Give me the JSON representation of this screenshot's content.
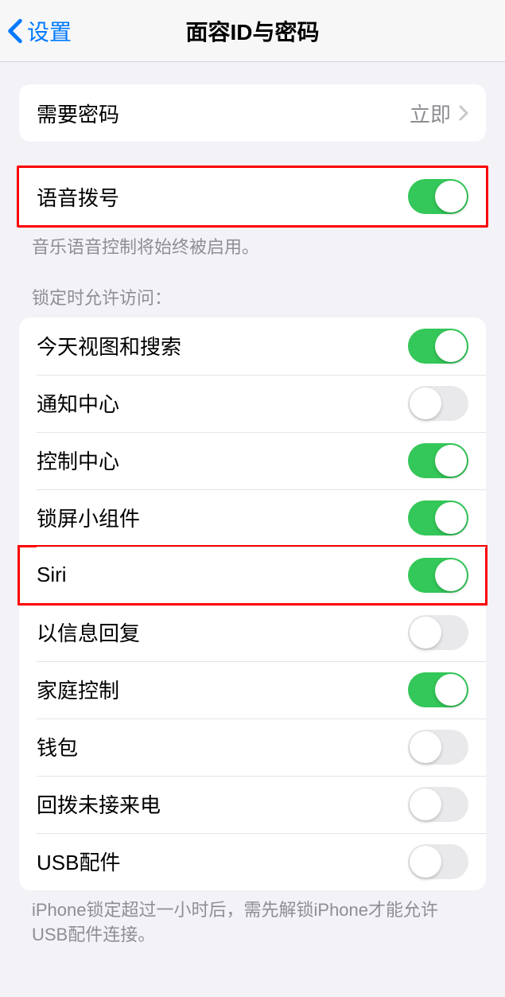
{
  "nav": {
    "back": "设置",
    "title": "面容ID与密码"
  },
  "group1": {
    "require_passcode": "需要密码",
    "require_passcode_value": "立即"
  },
  "group2": {
    "voice_dial": "语音拨号",
    "voice_dial_on": true,
    "footer": "音乐语音控制将始终被启用。"
  },
  "group3": {
    "header": "锁定时允许访问：",
    "items": [
      {
        "label": "今天视图和搜索",
        "on": true
      },
      {
        "label": "通知中心",
        "on": false
      },
      {
        "label": "控制中心",
        "on": true
      },
      {
        "label": "锁屏小组件",
        "on": true
      },
      {
        "label": "Siri",
        "on": true,
        "highlight": true
      },
      {
        "label": "以信息回复",
        "on": false
      },
      {
        "label": "家庭控制",
        "on": true
      },
      {
        "label": "钱包",
        "on": false
      },
      {
        "label": "回拨未接来电",
        "on": false
      },
      {
        "label": "USB配件",
        "on": false
      }
    ],
    "footer": "iPhone锁定超过一小时后，需先解锁iPhone才能允许USB配件连接。"
  }
}
